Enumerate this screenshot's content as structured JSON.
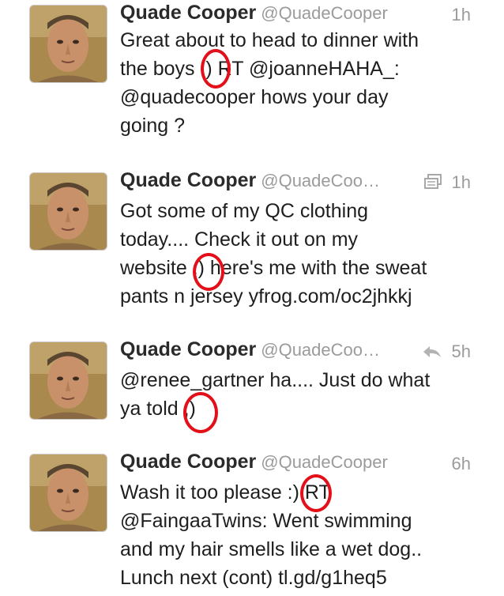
{
  "tweets": [
    {
      "name": "Quade Cooper",
      "handle": "@QuadeCooper",
      "time": "1h",
      "lines": [
        "Great about to head to dinner with",
        "the boys :) RT @joanneHAHA_:",
        "@quadecooper hows your day",
        "going ?"
      ],
      "icon": null
    },
    {
      "name": "Quade Cooper",
      "handle": "@QuadeCoo…",
      "time": "1h",
      "lines": [
        "Got some of my QC clothing",
        "today.... Check it out on my",
        "website :) here's me with the sweat",
        "pants n jersey yfrog.com/oc2jhkkj"
      ],
      "icon": "media-gallery-icon"
    },
    {
      "name": "Quade Cooper",
      "handle": "@QuadeCoo…",
      "time": "5h",
      "lines": [
        "@renee_gartner ha.... Just do what",
        "ya told ;)"
      ],
      "icon": "reply-arrow-icon"
    },
    {
      "name": "Quade Cooper",
      "handle": "@QuadeCooper",
      "time": "6h",
      "lines": [
        "Wash it too please :) RT",
        "@FaingaaTwins: Went swimming",
        "and my hair smells like a wet dog..",
        "Lunch next (cont) tl.gd/g1heq5"
      ],
      "icon": null
    }
  ],
  "colors": {
    "annotation": "#e3101a",
    "name": "#2a2a2a",
    "meta": "#9b9b9b",
    "divider": "#d8d8d8"
  }
}
